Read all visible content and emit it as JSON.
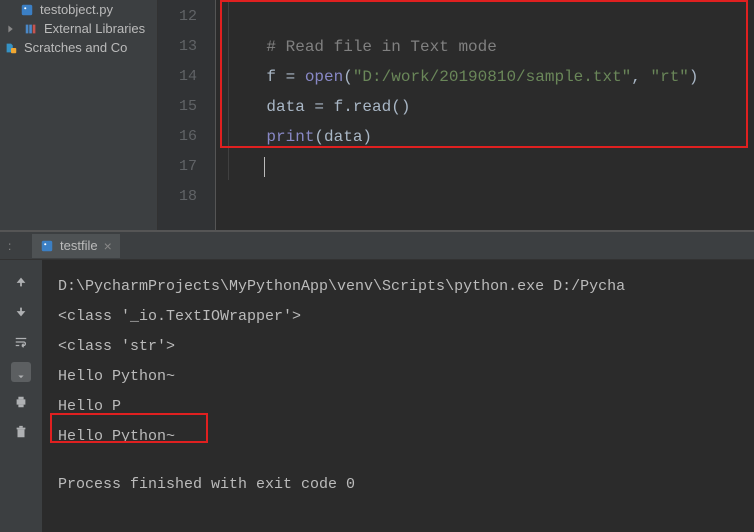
{
  "sidebar": {
    "items": [
      {
        "label": "testobject.py"
      },
      {
        "label": "External Libraries"
      },
      {
        "label": "Scratches and Co"
      }
    ]
  },
  "editor": {
    "lines": {
      "12": "12",
      "13": "13",
      "14": "14",
      "15": "15",
      "16": "16",
      "17": "17",
      "18": "18"
    },
    "code": {
      "comment": "# Read file in Text mode",
      "assign_f": "f = ",
      "open": "open",
      "open_args": "(",
      "str_path": "\"D:/work/20190810/sample.txt\"",
      "comma": ", ",
      "str_mode": "\"rt\"",
      "close_paren": ")",
      "assign_data": "data = f.read()",
      "print": "print",
      "print_arg": "(data)"
    }
  },
  "console": {
    "tab": "testfile",
    "output": {
      "line1": "D:\\PycharmProjects\\MyPythonApp\\venv\\Scripts\\python.exe D:/Pycha",
      "line2": "<class '_io.TextIOWrapper'>",
      "line3": "<class 'str'>",
      "line4": "Hello Python~",
      "line5": "Hello P",
      "line6": "Hello Python~",
      "line7": "Process finished with exit code 0"
    }
  }
}
